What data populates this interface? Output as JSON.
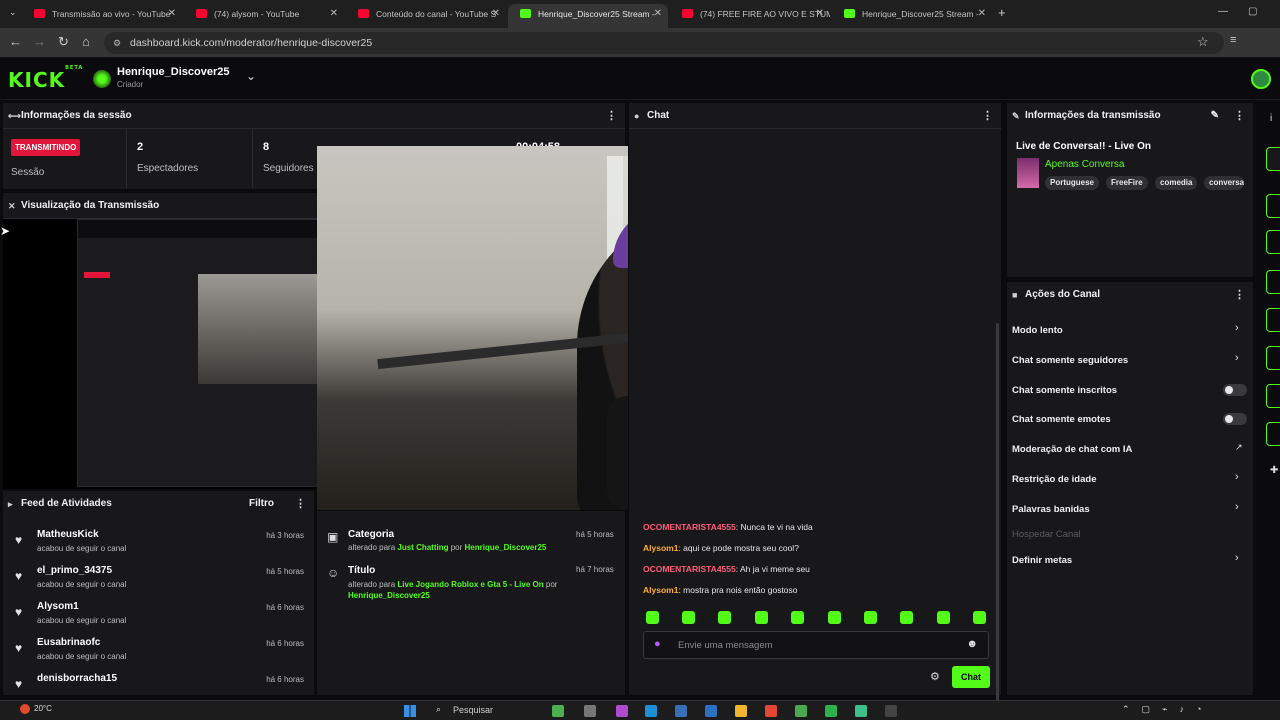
{
  "browser": {
    "tabs": [
      {
        "title": "Transmissão ao vivo - YouTube",
        "icon": "youtube-icon",
        "active": false
      },
      {
        "title": "(74) alysom - YouTube",
        "icon": "youtube-icon",
        "active": false
      },
      {
        "title": "Conteúdo do canal - YouTube S",
        "icon": "youtube-icon",
        "active": false
      },
      {
        "title": "Henrique_Discover25 Stream -",
        "icon": "kick-icon",
        "active": true
      },
      {
        "title": "(74) FREE FIRE AO VIVO E STUM",
        "icon": "youtube-icon",
        "active": false
      },
      {
        "title": "Henrique_Discover25 Stream -",
        "icon": "kick-icon",
        "active": false
      }
    ],
    "url": "dashboard.kick.com/moderator/henrique-discover25"
  },
  "header": {
    "logo": "KICK",
    "logo_badge": "BETA",
    "username": "Henrique_Discover25",
    "role": "Criador"
  },
  "session": {
    "title": "Informações da sessão",
    "status_badge": "TRANSMITINDO",
    "status_label": "Sessão",
    "viewers_value": "2",
    "viewers_label": "Espectadores",
    "followers_value": "8",
    "followers_label": "Seguidores",
    "uptime": "00:04:58"
  },
  "preview": {
    "title": "Visualização da Transmissão"
  },
  "feed": {
    "title": "Feed de Atividades",
    "filter_label": "Filtro",
    "items": [
      {
        "user": "MatheusKick",
        "action": "acabou de seguir o canal",
        "time": "há 3 horas"
      },
      {
        "user": "el_primo_34375",
        "action": "acabou de seguir o canal",
        "time": "há 5 horas"
      },
      {
        "user": "Alysom1",
        "action": "acabou de seguir o canal",
        "time": "há 6 horas"
      },
      {
        "user": "Eusabrinaofc",
        "action": "acabou de seguir o canal",
        "time": "há 6 horas"
      },
      {
        "user": "denisborracha15",
        "action": "acabou de seguir o canal",
        "time": "há 6 horas"
      }
    ]
  },
  "changes": {
    "category_title": "Categoria",
    "category_prefix": "alterado para",
    "category_value": "Just Chatting",
    "by": "por",
    "category_user": "Henrique_Discover25",
    "category_time": "há 5 horas",
    "title_title": "Título",
    "title_prefix": "alterado para",
    "title_value": "Live Jogando Roblox e Gta 5 - Live On",
    "title_user": "Henrique_Discover25",
    "title_time": "há 7 horas"
  },
  "chat": {
    "title": "Chat",
    "messages": [
      {
        "user": "OCOMENTARISTA4555",
        "text": ": Nunca te vi na vida",
        "color": "u1"
      },
      {
        "user": "Alysom1",
        "text": ": aqui ce pode mostra seu cool?",
        "color": "u2"
      },
      {
        "user": "OCOMENTARISTA4555",
        "text": ": Ah ja vi meme seu",
        "color": "u1"
      },
      {
        "user": "Alysom1",
        "text": ": mostra pra nois então gostoso",
        "color": "u2"
      }
    ],
    "input_placeholder": "Envie uma mensagem",
    "send_label": "Chat"
  },
  "stream_info": {
    "title": "Informações da transmissão",
    "stream_title": "Live de Conversa!! - Live On",
    "category": "Apenas Conversa",
    "tags": [
      "Portuguese",
      "FreeFire",
      "comedia",
      "conversa"
    ]
  },
  "channel_actions": {
    "title": "Ações do Canal",
    "items": [
      {
        "label": "Modo lento",
        "control": "chevron"
      },
      {
        "label": "Chat somente seguidores",
        "control": "chevron"
      },
      {
        "label": "Chat somente inscritos",
        "control": "toggle"
      },
      {
        "label": "Chat somente emotes",
        "control": "toggle"
      },
      {
        "label": "Moderação de chat com IA",
        "control": "external"
      },
      {
        "label": "Restrição de idade",
        "control": "chevron"
      },
      {
        "label": "Palavras banidas",
        "control": "chevron"
      },
      {
        "label": "Hospedar Canal",
        "control": "none"
      },
      {
        "label": "Definir metas",
        "control": "chevron"
      }
    ]
  },
  "taskbar": {
    "weather": "20°C",
    "search_placeholder": "Pesquisar"
  },
  "colors": {
    "brand": "#53fc18",
    "live_badge": "#e2153b",
    "panel": "#18181b",
    "background": "#0b0b0d"
  }
}
